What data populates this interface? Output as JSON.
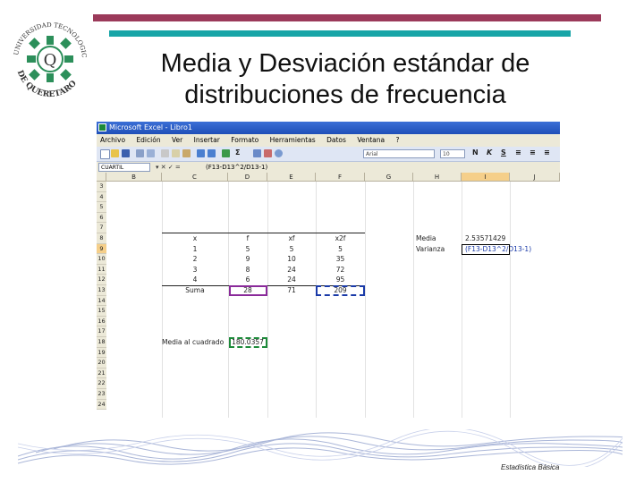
{
  "slide": {
    "title_line1": "Media y Desviación estándar de",
    "title_line2": "distribuciones de frecuencia",
    "footer": "Estadística Básica",
    "accent_maroon": "#9b3a5a",
    "accent_teal": "#17a5a7"
  },
  "logo": {
    "arc_top": "UNIVERSIDAD TECNOLOGICA",
    "arc_bottom": "DE QUERETARO",
    "letter": "Q"
  },
  "excel": {
    "window_title": "Microsoft Excel - Libro1",
    "menu": [
      "Archivo",
      "Edición",
      "Ver",
      "Insertar",
      "Formato",
      "Herramientas",
      "Datos",
      "Ventana",
      "?"
    ],
    "toolbar": {
      "font_name": "Arial",
      "font_size": "10",
      "bold": "N",
      "italic": "K",
      "underline": "S",
      "sum_symbol": "Σ"
    },
    "name_box": "CUARTIL",
    "fx_symbols": "▾ ✕ ✓ =",
    "formula": "(F13-D13^2/D13-1)",
    "columns": [
      "B",
      "C",
      "D",
      "E",
      "F",
      "G",
      "H",
      "I",
      "J"
    ],
    "selected_column": "I",
    "rows": [
      "3",
      "4",
      "5",
      "6",
      "7",
      "8",
      "9",
      "10",
      "11",
      "12",
      "13",
      "14",
      "15",
      "16",
      "17",
      "18",
      "19",
      "20",
      "21",
      "22",
      "23",
      "24"
    ],
    "selected_row": "9",
    "table": {
      "headers": [
        "x",
        "f",
        "xf",
        "x2f"
      ],
      "rows": [
        [
          "1",
          "5",
          "5",
          "5"
        ],
        [
          "2",
          "9",
          "10",
          "35"
        ],
        [
          "3",
          "8",
          "24",
          "72"
        ],
        [
          "4",
          "6",
          "24",
          "95"
        ]
      ],
      "total_label": "Suma",
      "totals": [
        "28",
        "71",
        "209"
      ]
    },
    "media_label": "Media",
    "media_value": "2.53571429",
    "varianza_label": "Varianza",
    "varianza_formula": "(F13-D13^2/D13-1)",
    "media_cuadrado_label": "Media al cuadrado",
    "media_cuadrado_value": "180.0357"
  }
}
